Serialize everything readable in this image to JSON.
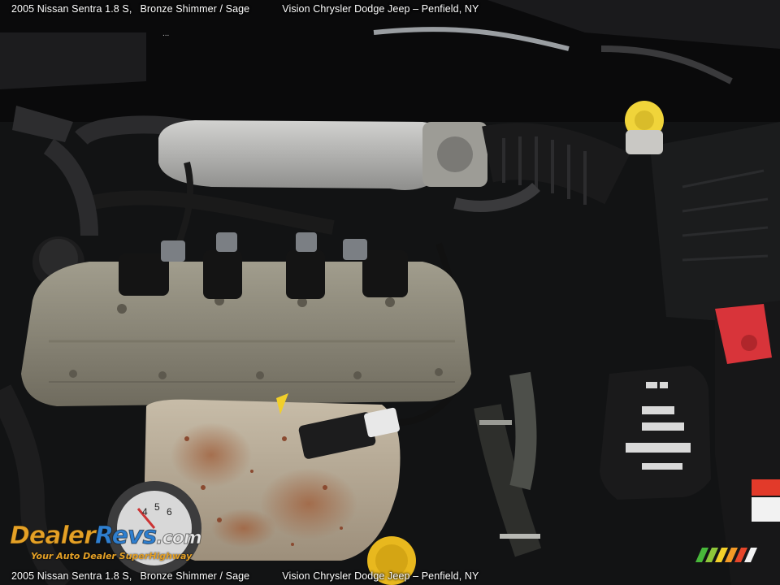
{
  "caption": {
    "year_model": "2005 Nissan Sentra 1.8 S,",
    "color": "Bronze Shimmer / Sage",
    "dealer": "Vision Chrysler Dodge Jeep – Penfield, NY",
    "dots": "..."
  },
  "logo": {
    "part1": "Dealer",
    "part2": "Revs",
    "part3": ".com",
    "tagline": "Your Auto Dealer SuperHighway"
  },
  "gauge": {
    "numbers": [
      "4",
      "5",
      "6"
    ]
  },
  "colors": {
    "cover": "#8f8b7c",
    "manifold": "#b8aa96",
    "rust": "#9a5a3a",
    "yellow_cap": "#f0d43a",
    "red_terminal": "#d8343a",
    "logo_orange": "#e5a126",
    "logo_blue": "#2f7fcf"
  }
}
